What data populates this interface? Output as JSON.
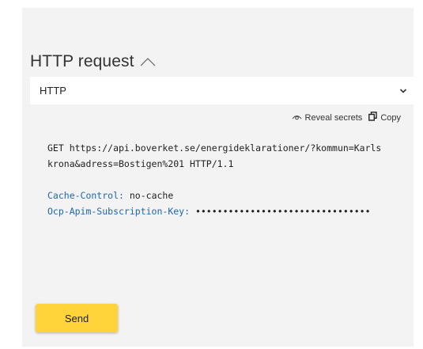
{
  "section": {
    "title": "HTTP request"
  },
  "protocol_select": {
    "value": "HTTP"
  },
  "actions": {
    "reveal_label": "Reveal secrets",
    "copy_label": "Copy"
  },
  "request": {
    "request_line_1": "GET https://api.boverket.se/energideklarationer/?kommun=Karls",
    "request_line_2": "krona&adress=Bostigen%201 HTTP/1.1",
    "headers": [
      {
        "name": "Cache-Control:",
        "value": "no-cache"
      },
      {
        "name": "Ocp-Apim-Subscription-Key:",
        "value": "••••••••••••••••••••••••••••••••"
      }
    ]
  },
  "send": {
    "label": "Send"
  },
  "colors": {
    "accent_button": "#ffd43b",
    "header_name": "#1e66b0",
    "panel_bg": "#f3f3f3"
  },
  "icons": {
    "collapse": "chevron-up-icon",
    "select": "chevron-down-icon",
    "reveal": "eye-icon",
    "copy": "copy-icon"
  }
}
